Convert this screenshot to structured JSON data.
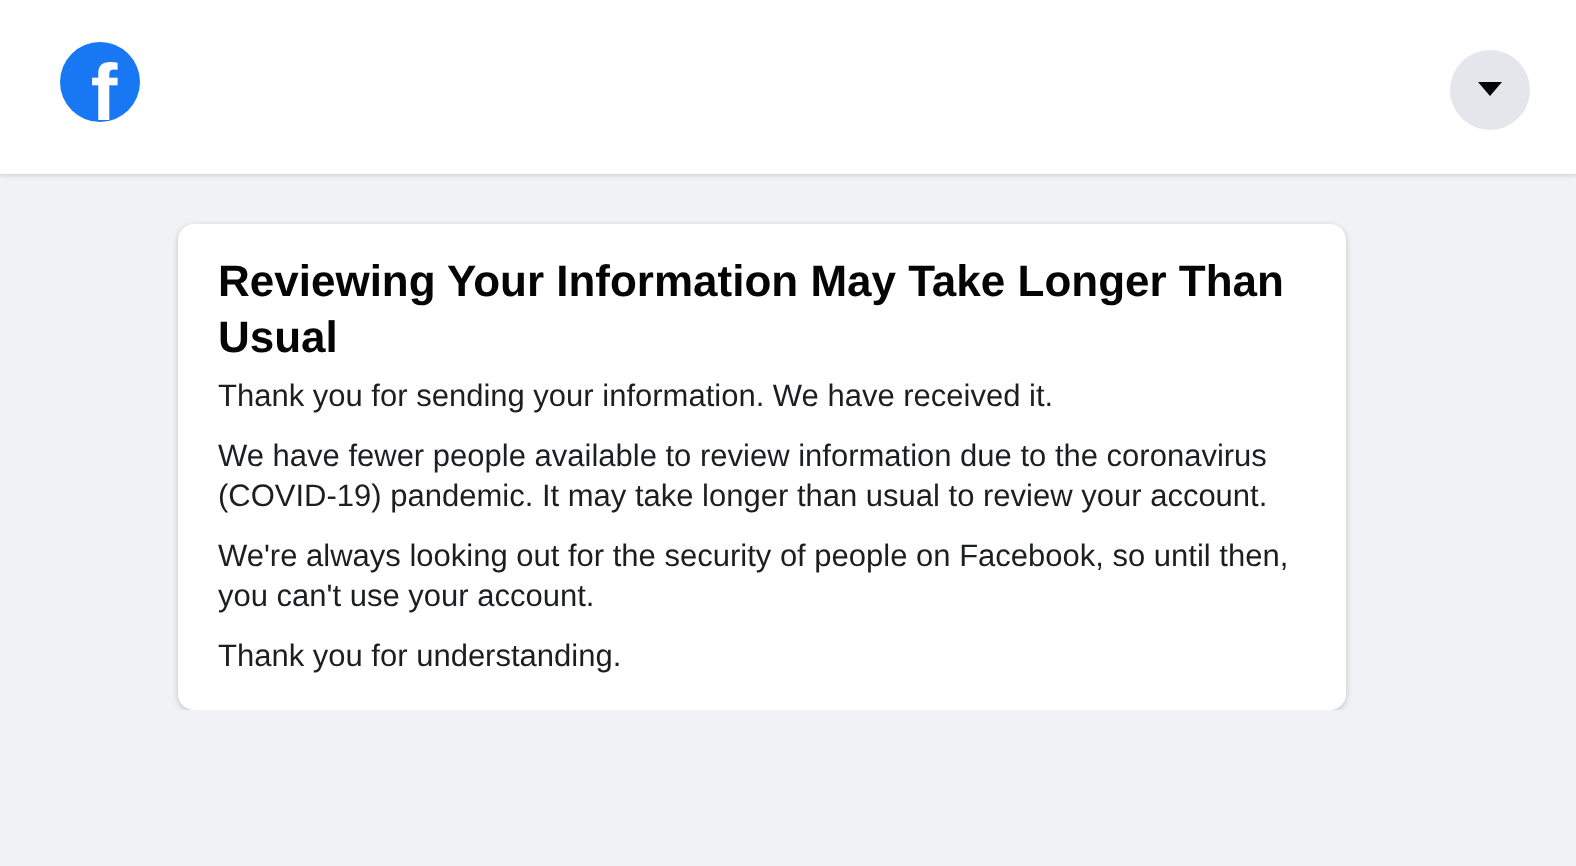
{
  "header": {
    "logo": "f"
  },
  "card": {
    "title": "Reviewing Your Information May Take Longer Than Usual",
    "paragraphs": [
      "Thank you for sending your information. We have received it.",
      "We have fewer people available to review information due to the coronavirus (COVID-19) pandemic. It may take longer than usual to review your account.",
      "We're always looking out for the security of people on Facebook, so until then, you can't use your account.",
      "Thank you for understanding."
    ]
  }
}
